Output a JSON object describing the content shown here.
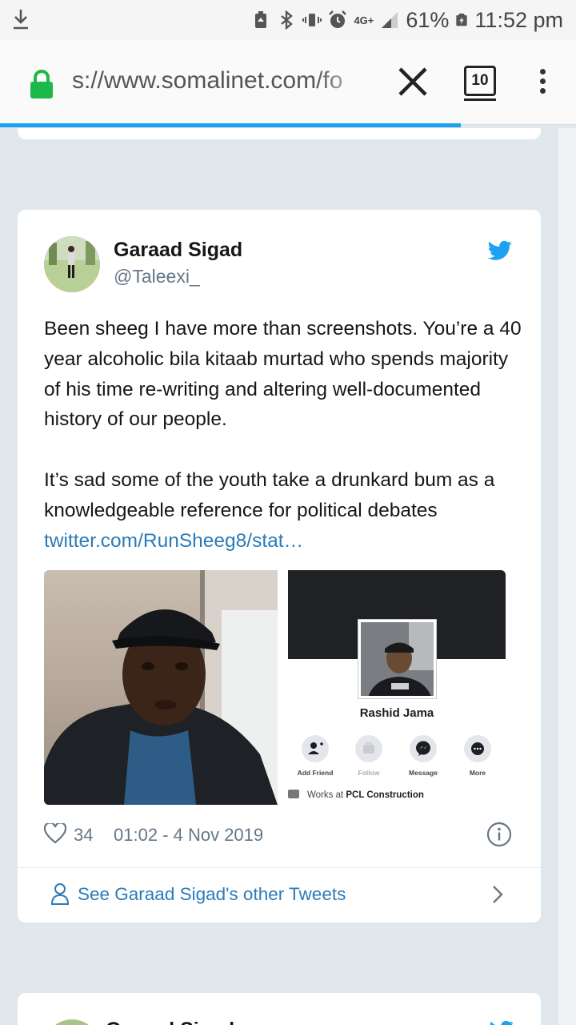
{
  "statusbar": {
    "network": "4G+",
    "battery": "61%",
    "time": "11:52 pm"
  },
  "browser": {
    "url": "s://www.somalinet.com/fo",
    "tab_count": "10",
    "load_progress": 0.8
  },
  "tweet": {
    "author_name": "Garaad Sigad",
    "author_handle": "@Taleexi_",
    "text_line1": "Been sheeg I have more than screenshots. You’re a 40 year alcoholic bila kitaab murtad who spends majority of his time re-writing and altering well-documented history of our people.",
    "text_line2": "It’s sad some of the youth take a drunkard bum as a knowledgeable reference for political debates ",
    "link": "twitter.com/RunSheeg8/stat…",
    "likes": "34",
    "date": "01:02 - 4 Nov 2019",
    "see_other": "See Garaad Sigad's other Tweets"
  },
  "media_profile": {
    "name": "Rashid Jama",
    "actions": [
      "Add Friend",
      "Follow",
      "Message",
      "More"
    ],
    "works_prefix": "Works at ",
    "works_company": "PCL Construction"
  },
  "next_tweet": {
    "author_name": "Garaad Sigad"
  },
  "colors": {
    "twitter_blue": "#1da1f2",
    "link_blue": "#2b7bb9",
    "lock_green": "#1db84a"
  }
}
